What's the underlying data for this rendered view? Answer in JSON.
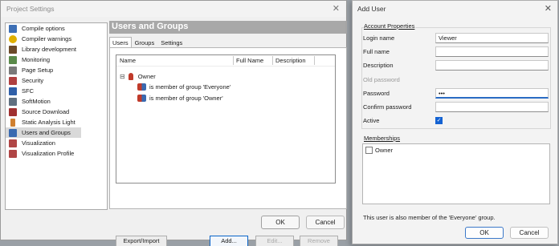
{
  "project_settings": {
    "title": "Project Settings",
    "close_glyph": "✕",
    "categories": [
      {
        "label": "Compile options",
        "icon": "compile-options-icon",
        "color": "#3d6fb5"
      },
      {
        "label": "Compiler warnings",
        "icon": "warning-icon",
        "color": "#e0b000"
      },
      {
        "label": "Library development",
        "icon": "library-icon",
        "color": "#6b4a2a"
      },
      {
        "label": "Monitoring",
        "icon": "monitoring-icon",
        "color": "#5a8a4a"
      },
      {
        "label": "Page Setup",
        "icon": "page-setup-icon",
        "color": "#7a7a7a"
      },
      {
        "label": "Security",
        "icon": "security-icon",
        "color": "#b04040"
      },
      {
        "label": "SFC",
        "icon": "sfc-icon",
        "color": "#2f5fa8"
      },
      {
        "label": "SoftMotion",
        "icon": "softmotion-icon",
        "color": "#607080"
      },
      {
        "label": "Source Download",
        "icon": "source-download-icon",
        "color": "#a03030"
      },
      {
        "label": "Static Analysis Light",
        "icon": "static-analysis-icon",
        "color": "#d08030"
      },
      {
        "label": "Users and Groups",
        "icon": "users-groups-icon",
        "color": "#3a6ab0"
      },
      {
        "label": "Visualization",
        "icon": "visualization-icon",
        "color": "#b04545"
      },
      {
        "label": "Visualization Profile",
        "icon": "visualization-profile-icon",
        "color": "#b04545"
      }
    ],
    "selected_category": "Users and Groups",
    "header": "Users and Groups",
    "tabs": [
      "Users",
      "Groups",
      "Settings"
    ],
    "active_tab": "Users",
    "columns": [
      "Name",
      "Full Name",
      "Description"
    ],
    "rows": [
      {
        "expander": "⊟",
        "label": "Owner",
        "icon": "user-icon"
      },
      {
        "label": "is member of group 'Everyone'",
        "icon": "group-icon"
      },
      {
        "label": "is member of group 'Owner'",
        "icon": "group-icon"
      }
    ],
    "buttons": {
      "export_import": "Export/Import",
      "add": "Add...",
      "edit": "Edit...",
      "remove": "Remove"
    },
    "footer": {
      "ok": "OK",
      "cancel": "Cancel"
    }
  },
  "add_user": {
    "title": "Add User",
    "close_glyph": "✕",
    "account_properties_label": "Account Properties",
    "fields": {
      "login_name": {
        "label": "Login name",
        "value": "Viewer"
      },
      "full_name": {
        "label": "Full name",
        "value": ""
      },
      "description": {
        "label": "Description",
        "value": ""
      },
      "old_password": {
        "label": "Old password"
      },
      "password": {
        "label": "Password",
        "value": "•••"
      },
      "confirm_password": {
        "label": "Confirm password",
        "value": ""
      },
      "active": {
        "label": "Active",
        "checked": true
      }
    },
    "checkmark": "✓",
    "memberships_label": "Memberships",
    "memberships": [
      {
        "label": "Owner",
        "checked": false
      }
    ],
    "info_text": "This user is also member of the 'Everyone' group.",
    "ok": "OK",
    "cancel": "Cancel"
  },
  "colors": {
    "accent": "#1462d2",
    "header_bar": "#a8a8a8",
    "selection": "#d9d9d9"
  }
}
